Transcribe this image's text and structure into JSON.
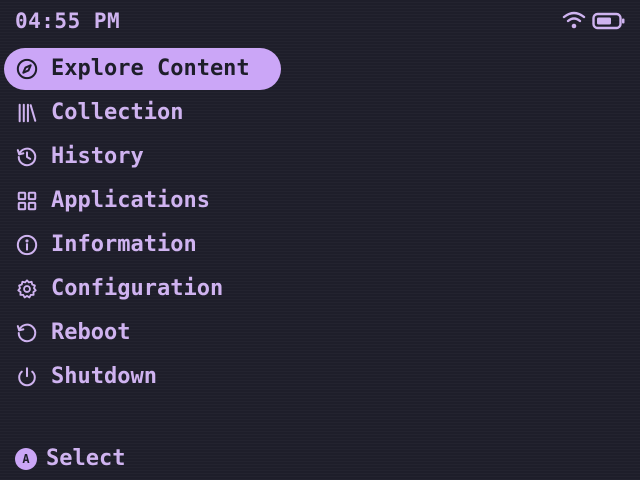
{
  "status_bar": {
    "time": "04:55 PM",
    "wifi_icon": "wifi-icon",
    "battery_icon": "battery-icon"
  },
  "menu": {
    "items": [
      {
        "label": "Explore Content",
        "icon": "compass-icon",
        "selected": true
      },
      {
        "label": "Collection",
        "icon": "library-icon",
        "selected": false
      },
      {
        "label": "History",
        "icon": "history-icon",
        "selected": false
      },
      {
        "label": "Applications",
        "icon": "grid-icon",
        "selected": false
      },
      {
        "label": "Information",
        "icon": "info-icon",
        "selected": false
      },
      {
        "label": "Configuration",
        "icon": "gear-icon",
        "selected": false
      },
      {
        "label": "Reboot",
        "icon": "restart-icon",
        "selected": false
      },
      {
        "label": "Shutdown",
        "icon": "power-icon",
        "selected": false
      }
    ]
  },
  "footer": {
    "button_glyph": "A",
    "action_label": "Select"
  },
  "colors": {
    "background": "#1e1e2a",
    "accent": "#cba6f7",
    "text": "#cfb3f0",
    "selected_text": "#1e1e2a"
  }
}
